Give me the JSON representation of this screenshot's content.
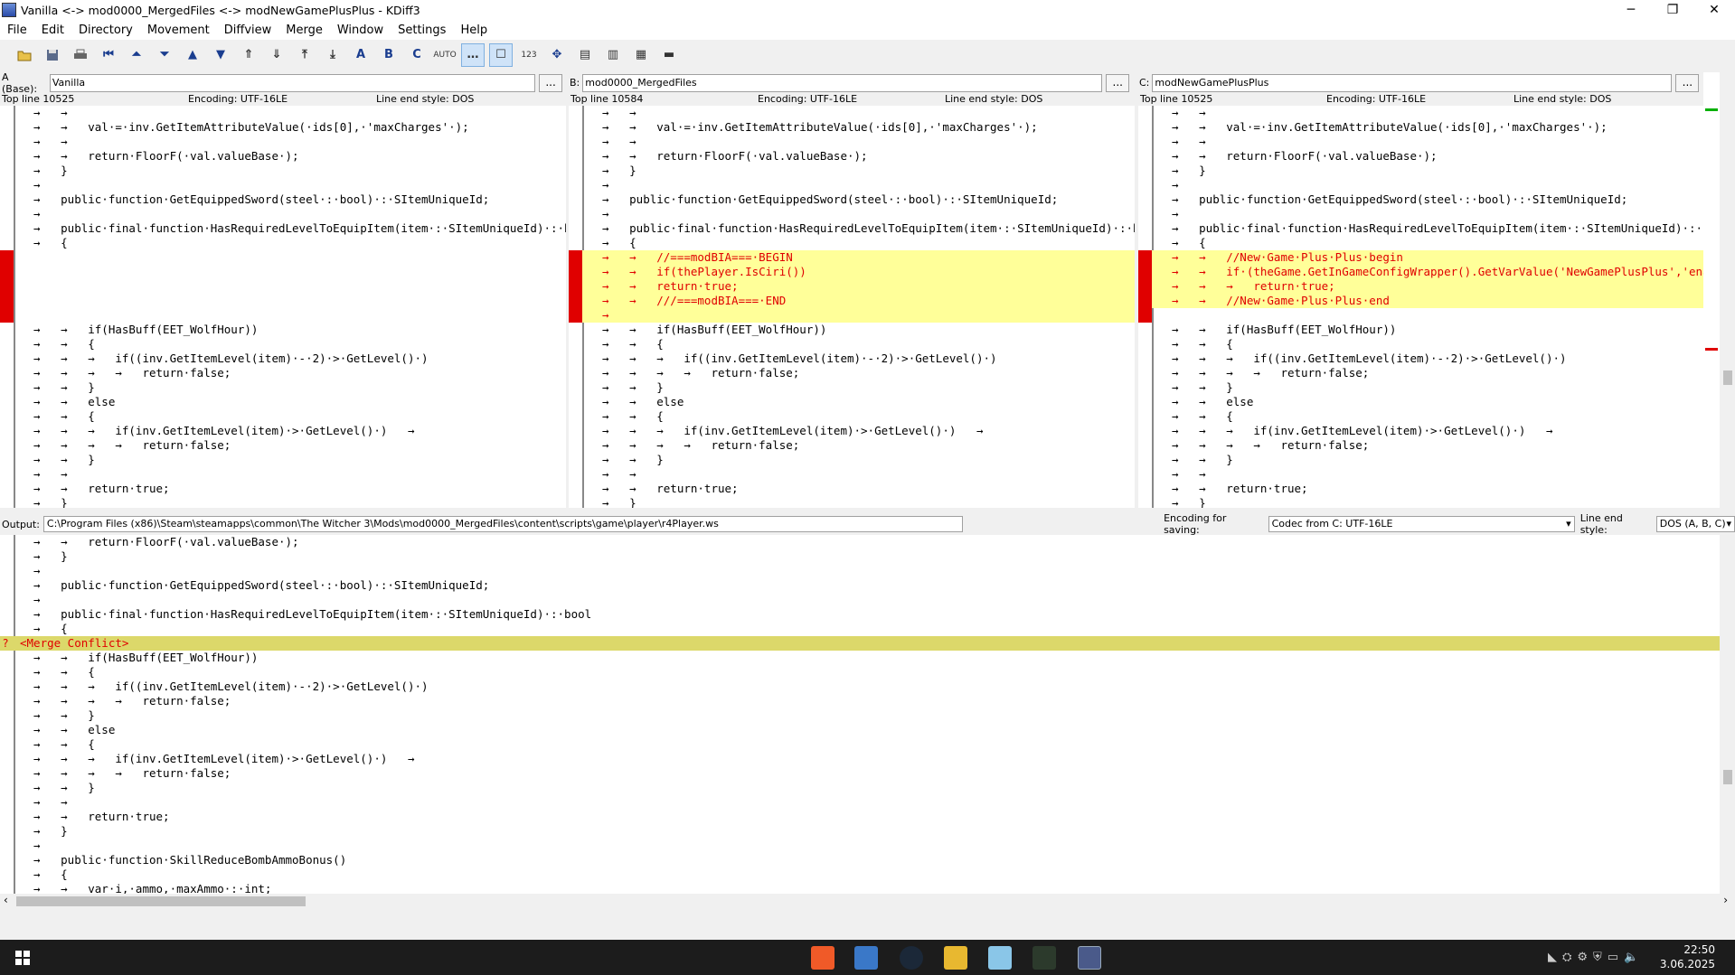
{
  "window": {
    "title": "Vanilla <-> mod0000_MergedFiles <-> modNewGamePlusPlus - KDiff3",
    "controls": {
      "minimize": "─",
      "maximize": "❐",
      "close": "✕"
    }
  },
  "menu": [
    "File",
    "Edit",
    "Directory",
    "Movement",
    "Diffview",
    "Merge",
    "Window",
    "Settings",
    "Help"
  ],
  "toolbar": {
    "icons": [
      "open-icon",
      "save-icon",
      "print-icon",
      "go-top-icon",
      "go-current-icon",
      "go-bottom-icon",
      "prev-delta-icon",
      "next-delta-icon",
      "prev-conflict-icon",
      "next-conflict-icon",
      "prev-unsolved-icon",
      "next-unsolved-icon",
      "select-a-icon",
      "select-b-icon",
      "select-c-icon",
      "auto-advance-icon",
      "show-whitespace-icon",
      "show-whitespace-chars-icon",
      "line-numbers-icon",
      "move-icon",
      "split-icon",
      "split2-icon",
      "split3-icon",
      "overview-icon"
    ],
    "labels": {
      "a": "A",
      "b": "B",
      "c": "C",
      "auto": "AUTO",
      "ln": "123"
    }
  },
  "panes": [
    {
      "label": "A (Base):",
      "path": "Vanilla",
      "encoding": "Encoding: UTF-16LE",
      "line_end": "Line end style: DOS",
      "top_line": "Top line 10525"
    },
    {
      "label": "B:",
      "path": "mod0000_MergedFiles",
      "encoding": "Encoding: UTF-16LE",
      "line_end": "Line end style: DOS",
      "top_line": "Top line 10584"
    },
    {
      "label": "C:",
      "path": "modNewGamePlusPlus",
      "encoding": "Encoding: UTF-16LE",
      "line_end": "Line end style: DOS",
      "top_line": "Top line 10525"
    }
  ],
  "browse_label": "...",
  "code_common": [
    "  →   →   ",
    "  →   →   val·=·inv.GetItemAttributeValue(·ids[0],·'maxCharges'·);",
    "  →   →   ",
    "  →   →   return·FloorF(·val.valueBase·);",
    "  →   }",
    "  →   ",
    "  →   public·function·GetEquippedSword(steel·:·bool)·:·SItemUniqueId;",
    "  →   ",
    "  →   public·final·function·HasRequiredLevelToEquipItem(item·:·SItemUniqueId)·:·bool",
    "  →   {"
  ],
  "code_after": [
    "  →   →   if(HasBuff(EET_WolfHour))",
    "  →   →   {",
    "  →   →   →   if((inv.GetItemLevel(item)·-·2)·>·GetLevel()·)",
    "  →   →   →   →   return·false;",
    "  →   →   }",
    "  →   →   else",
    "  →   →   {",
    "  →   →   →   if(inv.GetItemLevel(item)·>·GetLevel()·)   →",
    "  →   →   →   →   return·false;",
    "  →   →   }",
    "  →   →   ",
    "  →   →   return·true;",
    "  →   }"
  ],
  "conflict_b": [
    "  →   →   //===modBIA===·BEGIN",
    "  →   →   if(thePlayer.IsCiri())",
    "  →   →   return·true;",
    "  →   →   ///===modBIA===·END",
    "  →   "
  ],
  "conflict_c": [
    "  →   →   //New·Game·Plus·Plus·begin",
    "  →   →   if·(theGame.GetInGameConfigWrapper().GetVarValue('NewGamePlusPlus','enable'))",
    "  →   →   →   return·true;",
    "  →   →   //New·Game·Plus·Plus·end"
  ],
  "output": {
    "label": "Output:",
    "path": "C:\\Program Files (x86)\\Steam\\steamapps\\common\\The Witcher 3\\Mods\\mod0000_MergedFiles\\content\\scripts\\game\\player\\r4Player.ws",
    "encoding_label": "Encoding for saving:",
    "encoding_value": "Codec from C: UTF-16LE",
    "line_end_label": "Line end style:",
    "line_end_value": "DOS (A, B, C)",
    "conflict_text": "<Merge Conflict>",
    "conflict_marker": "?",
    "lines_before": [
      "  →   →   return·FloorF(·val.valueBase·);",
      "  →   }",
      "  →   ",
      "  →   public·function·GetEquippedSword(steel·:·bool)·:·SItemUniqueId;",
      "  →   ",
      "  →   public·final·function·HasRequiredLevelToEquipItem(item·:·SItemUniqueId)·:·bool",
      "  →   {"
    ],
    "lines_after": [
      "  →   →   if(HasBuff(EET_WolfHour))",
      "  →   →   {",
      "  →   →   →   if((inv.GetItemLevel(item)·-·2)·>·GetLevel()·)",
      "  →   →   →   →   return·false;",
      "  →   →   }",
      "  →   →   else",
      "  →   →   {",
      "  →   →   →   if(inv.GetItemLevel(item)·>·GetLevel()·)   →",
      "  →   →   →   →   return·false;",
      "  →   →   }",
      "  →   →   ",
      "  →   →   return·true;",
      "  →   }",
      "  →   ",
      "  →   public·function·SkillReduceBombAmmoBonus()",
      "  →   {",
      "  →   →   var·i,·ammo,·maxAmmo·:·int;"
    ]
  },
  "taskbar": {
    "time": "22:50",
    "date": "3.06.2025",
    "apps": [
      "windows-start-icon",
      "brave-icon",
      "app2-icon",
      "steam-icon",
      "file-explorer-icon",
      "notepad-icon",
      "witcher-icon",
      "kdiff3-icon"
    ]
  },
  "colors": {
    "conflict_bar": "#e00000",
    "highlight": "#ffff99",
    "conflict_line": "#dcd86a"
  }
}
